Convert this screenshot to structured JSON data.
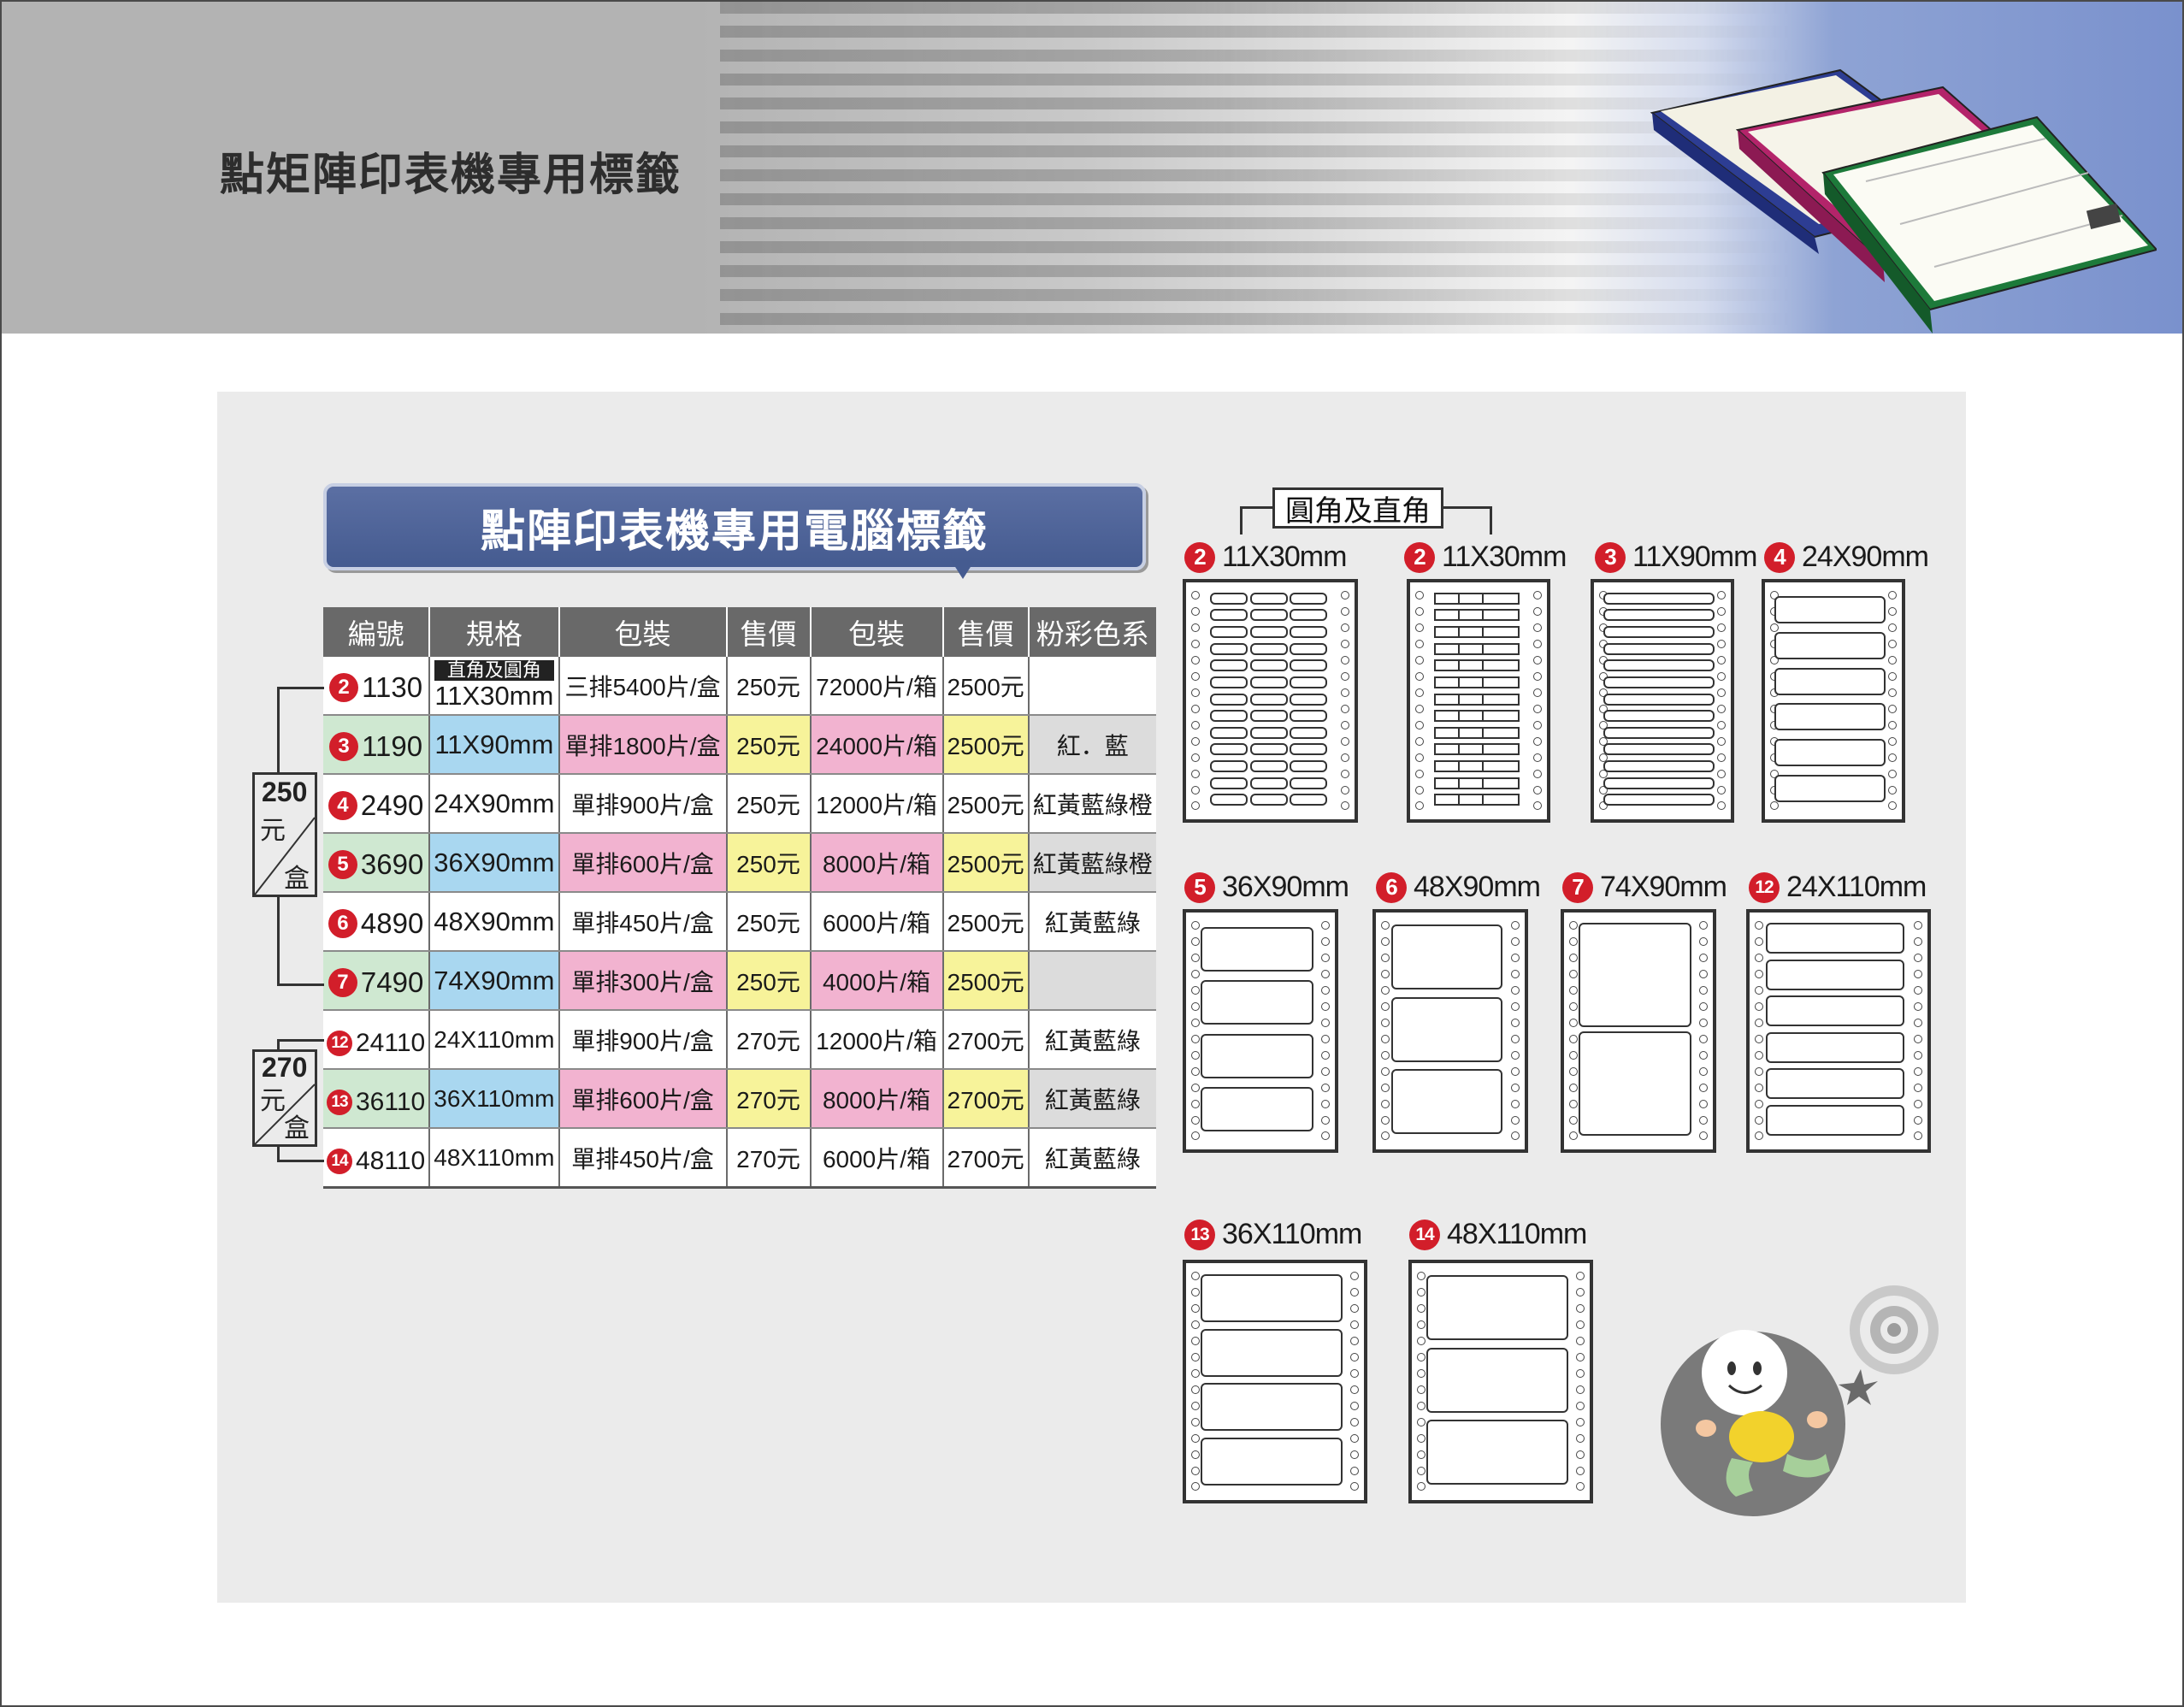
{
  "header": {
    "title": "點矩陣印表機專用標籤"
  },
  "banner": {
    "title": "點陣印表機專用電腦標籤"
  },
  "table": {
    "headers": [
      "編號",
      "規格",
      "包裝",
      "售價",
      "包裝",
      "售價",
      "粉彩色系"
    ],
    "rows": [
      {
        "mark": "2",
        "code": "1130",
        "tag": "直角及圓角",
        "spec": "11X30mm",
        "pack_box": "三排5400片/盒",
        "price_box": "250元",
        "pack_case": "72000片/箱",
        "price_case": "2500元",
        "colors": ""
      },
      {
        "mark": "3",
        "code": "1190",
        "tag": "",
        "spec": "11X90mm",
        "pack_box": "單排1800片/盒",
        "price_box": "250元",
        "pack_case": "24000片/箱",
        "price_case": "2500元",
        "colors": "紅．藍"
      },
      {
        "mark": "4",
        "code": "2490",
        "tag": "",
        "spec": "24X90mm",
        "pack_box": "單排900片/盒",
        "price_box": "250元",
        "pack_case": "12000片/箱",
        "price_case": "2500元",
        "colors": "紅黃藍綠橙"
      },
      {
        "mark": "5",
        "code": "3690",
        "tag": "",
        "spec": "36X90mm",
        "pack_box": "單排600片/盒",
        "price_box": "250元",
        "pack_case": "8000片/箱",
        "price_case": "2500元",
        "colors": "紅黃藍綠橙"
      },
      {
        "mark": "6",
        "code": "4890",
        "tag": "",
        "spec": "48X90mm",
        "pack_box": "單排450片/盒",
        "price_box": "250元",
        "pack_case": "6000片/箱",
        "price_case": "2500元",
        "colors": "紅黃藍綠"
      },
      {
        "mark": "7",
        "code": "7490",
        "tag": "",
        "spec": "74X90mm",
        "pack_box": "單排300片/盒",
        "price_box": "250元",
        "pack_case": "4000片/箱",
        "price_case": "2500元",
        "colors": ""
      },
      {
        "mark": "12",
        "code": "24110",
        "tag": "",
        "spec": "24X110mm",
        "pack_box": "單排900片/盒",
        "price_box": "270元",
        "pack_case": "12000片/箱",
        "price_case": "2700元",
        "colors": "紅黃藍綠"
      },
      {
        "mark": "13",
        "code": "36110",
        "tag": "",
        "spec": "36X110mm",
        "pack_box": "單排600片/盒",
        "price_box": "270元",
        "pack_case": "8000片/箱",
        "price_case": "2700元",
        "colors": "紅黃藍綠"
      },
      {
        "mark": "14",
        "code": "48110",
        "tag": "",
        "spec": "48X110mm",
        "pack_box": "單排450片/盒",
        "price_box": "270元",
        "pack_case": "6000片/箱",
        "price_case": "2700元",
        "colors": "紅黃藍綠"
      }
    ]
  },
  "price_groups": [
    {
      "amount": "250",
      "unit": "元",
      "per": "盒"
    },
    {
      "amount": "270",
      "unit": "元",
      "per": "盒"
    }
  ],
  "diagrams": {
    "corner_title": "圓角及直角",
    "items": [
      {
        "mark": "2",
        "size": "11X30mm"
      },
      {
        "mark": "2",
        "size": "11X30mm"
      },
      {
        "mark": "3",
        "size": "11X90mm"
      },
      {
        "mark": "4",
        "size": "24X90mm"
      },
      {
        "mark": "5",
        "size": "36X90mm"
      },
      {
        "mark": "6",
        "size": "48X90mm"
      },
      {
        "mark": "7",
        "size": "74X90mm"
      },
      {
        "mark": "12",
        "size": "24X110mm"
      },
      {
        "mark": "13",
        "size": "36X110mm"
      },
      {
        "mark": "14",
        "size": "48X110mm"
      }
    ]
  },
  "colors": {
    "header_gray": "#b3b3b3",
    "header_blue": "#7a91cd",
    "banner_blue": "#4f6499",
    "marker_red": "#d21e2a",
    "panel_gray": "#ebebeb",
    "cell_green": "#cfe8d1",
    "cell_blue": "#a9d7f0",
    "cell_pink": "#f2b3d0",
    "cell_yellow": "#f7f39a",
    "cell_gray": "#dcdcdc"
  }
}
